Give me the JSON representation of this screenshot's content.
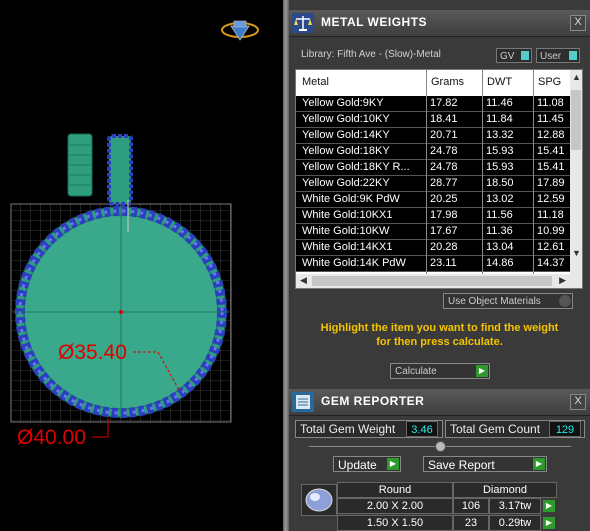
{
  "viewport": {
    "dimension_inner": "Ø35.40",
    "dimension_outer": "Ø40.00"
  },
  "metal_weights": {
    "title": "METAL WEIGHTS",
    "close_label": "X",
    "library_label": "Library: Fifth Ave - (Slow)-Metal",
    "gv_label": "GV",
    "user_label": "User",
    "columns": [
      "Metal",
      "Grams",
      "DWT",
      "SPG"
    ],
    "rows": [
      {
        "metal": "Yellow Gold:9KY",
        "grams": "17.82",
        "dwt": "11.46",
        "spg": "11.08"
      },
      {
        "metal": "Yellow Gold:10KY",
        "grams": "18.41",
        "dwt": "11.84",
        "spg": "11.45"
      },
      {
        "metal": "Yellow Gold:14KY",
        "grams": "20.71",
        "dwt": "13.32",
        "spg": "12.88"
      },
      {
        "metal": "Yellow Gold:18KY",
        "grams": "24.78",
        "dwt": "15.93",
        "spg": "15.41"
      },
      {
        "metal": "Yellow Gold:18KY R...",
        "grams": "24.78",
        "dwt": "15.93",
        "spg": "15.41"
      },
      {
        "metal": "Yellow Gold:22KY",
        "grams": "28.77",
        "dwt": "18.50",
        "spg": "17.89"
      },
      {
        "metal": "White Gold:9K PdW",
        "grams": "20.25",
        "dwt": "13.02",
        "spg": "12.59"
      },
      {
        "metal": "White Gold:10KX1",
        "grams": "17.98",
        "dwt": "11.56",
        "spg": "11.18"
      },
      {
        "metal": "White Gold:10KW",
        "grams": "17.67",
        "dwt": "11.36",
        "spg": "10.99"
      },
      {
        "metal": "White Gold:14KX1",
        "grams": "20.28",
        "dwt": "13.04",
        "spg": "12.61"
      },
      {
        "metal": "White Gold:14K PdW",
        "grams": "23.11",
        "dwt": "14.86",
        "spg": "14.37"
      }
    ],
    "use_object_materials": "Use Object Materials",
    "hint_line1": "Highlight the item you want to find the weight",
    "hint_line2": "for then press calculate.",
    "calculate_label": "Calculate"
  },
  "gem_reporter": {
    "title": "GEM REPORTER",
    "close_label": "X",
    "total_gem_weight_label": "Total Gem Weight",
    "total_gem_weight_value": "3.46",
    "total_gem_count_label": "Total Gem Count",
    "total_gem_count_value": "129",
    "update_label": "Update",
    "save_report_label": "Save Report",
    "shape": "Round",
    "material": "Diamond",
    "rows": [
      {
        "size": "2.00 X 2.00",
        "count": "106",
        "tw": "3.17tw"
      },
      {
        "size": "1.50 X 1.50",
        "count": "23",
        "tw": "0.29tw"
      }
    ]
  },
  "colors": {
    "accent_green": "#2d9a2d",
    "hint_yellow": "#f5c400",
    "value_cyan": "#22eeee",
    "dimension_red": "#e00000",
    "ring_teal": "#2e9e7e"
  }
}
